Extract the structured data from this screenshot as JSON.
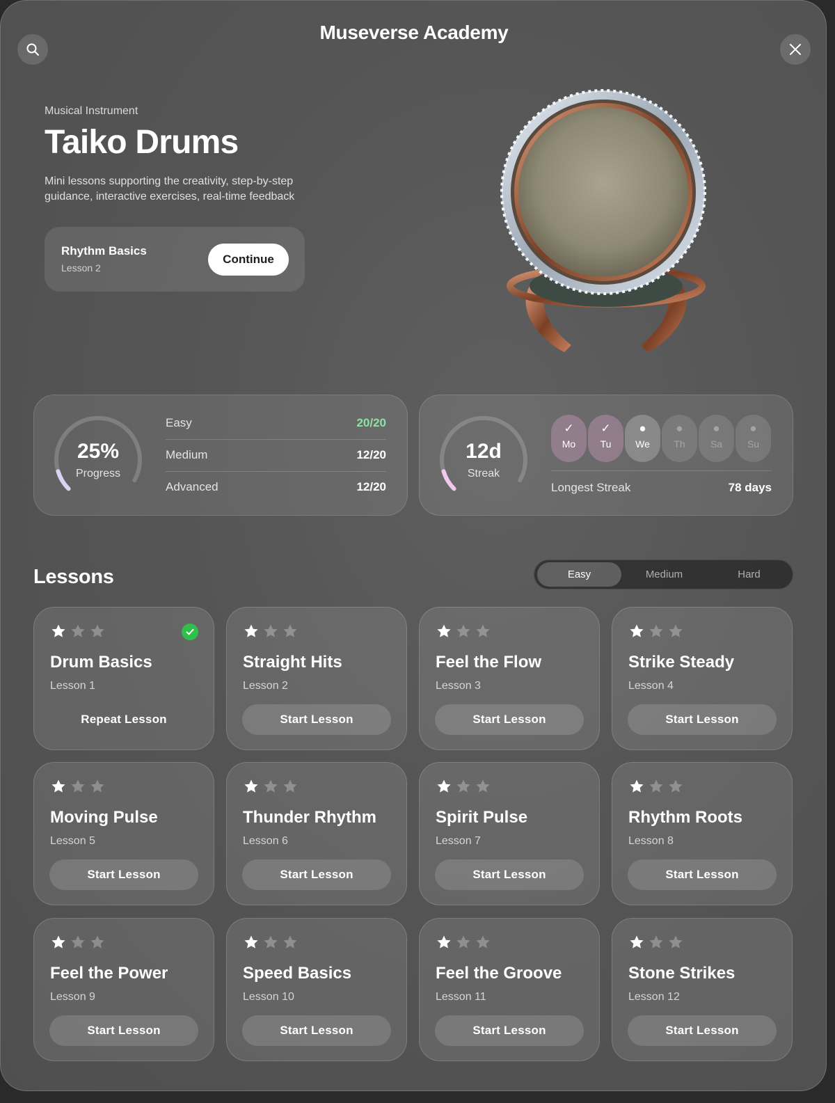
{
  "app": {
    "title": "Museverse Academy"
  },
  "hero": {
    "kicker": "Musical Instrument",
    "title": "Taiko Drums",
    "description": "Mini lessons supporting the creativity, step-by-step guidance, interactive exercises, real-time feedback"
  },
  "continue": {
    "title": "Rhythm Basics",
    "subtitle": "Lesson 2",
    "button": "Continue"
  },
  "progress": {
    "value": "25%",
    "label": "Progress",
    "fraction": 0.25,
    "levels": [
      {
        "name": "Easy",
        "value": "20/20"
      },
      {
        "name": "Medium",
        "value": "12/20"
      },
      {
        "name": "Advanced",
        "value": "12/20"
      }
    ]
  },
  "streak": {
    "value": "12d",
    "label": "Streak",
    "fraction": 0.25,
    "days": [
      {
        "label": "Mo",
        "mark": "✓",
        "state": "done"
      },
      {
        "label": "Tu",
        "mark": "✓",
        "state": "done"
      },
      {
        "label": "We",
        "mark": "●",
        "state": "today"
      },
      {
        "label": "Th",
        "mark": "●",
        "state": "future"
      },
      {
        "label": "Sa",
        "mark": "●",
        "state": "future"
      },
      {
        "label": "Su",
        "mark": "●",
        "state": "future"
      }
    ],
    "longest_label": "Longest Streak",
    "longest_value": "78 days"
  },
  "lessons": {
    "heading": "Lessons",
    "tabs": [
      "Easy",
      "Medium",
      "Hard"
    ],
    "active_tab": "Easy",
    "items": [
      {
        "title": "Drum Basics",
        "subtitle": "Lesson 1",
        "button": "Repeat Lesson",
        "stars": 1,
        "completed": true
      },
      {
        "title": "Straight Hits",
        "subtitle": "Lesson 2",
        "button": "Start Lesson",
        "stars": 1,
        "completed": false
      },
      {
        "title": "Feel the Flow",
        "subtitle": "Lesson 3",
        "button": "Start Lesson",
        "stars": 1,
        "completed": false
      },
      {
        "title": "Strike Steady",
        "subtitle": "Lesson 4",
        "button": "Start Lesson",
        "stars": 1,
        "completed": false
      },
      {
        "title": "Moving Pulse",
        "subtitle": "Lesson 5",
        "button": "Start Lesson",
        "stars": 1,
        "completed": false
      },
      {
        "title": "Thunder Rhythm",
        "subtitle": "Lesson 6",
        "button": "Start Lesson",
        "stars": 1,
        "completed": false
      },
      {
        "title": "Spirit Pulse",
        "subtitle": "Lesson 7",
        "button": "Start Lesson",
        "stars": 1,
        "completed": false
      },
      {
        "title": "Rhythm Roots",
        "subtitle": "Lesson 8",
        "button": "Start Lesson",
        "stars": 1,
        "completed": false
      },
      {
        "title": "Feel the Power",
        "subtitle": "Lesson 9",
        "button": "Start Lesson",
        "stars": 1,
        "completed": false
      },
      {
        "title": "Speed Basics",
        "subtitle": "Lesson 10",
        "button": "Start Lesson",
        "stars": 1,
        "completed": false
      },
      {
        "title": "Feel the Groove",
        "subtitle": "Lesson 11",
        "button": "Start Lesson",
        "stars": 1,
        "completed": false
      },
      {
        "title": "Stone Strikes",
        "subtitle": "Lesson 12",
        "button": "Start Lesson",
        "stars": 1,
        "completed": false
      }
    ]
  },
  "icons": {
    "search": "search-icon",
    "close": "close-icon",
    "star": "star-icon",
    "check": "checkmark-icon"
  },
  "colors": {
    "progress_ring": "#d9d3f2",
    "streak_ring": "#f2c9ee",
    "done_green": "#8fe0a5",
    "badge_green": "#2fbf4c"
  }
}
